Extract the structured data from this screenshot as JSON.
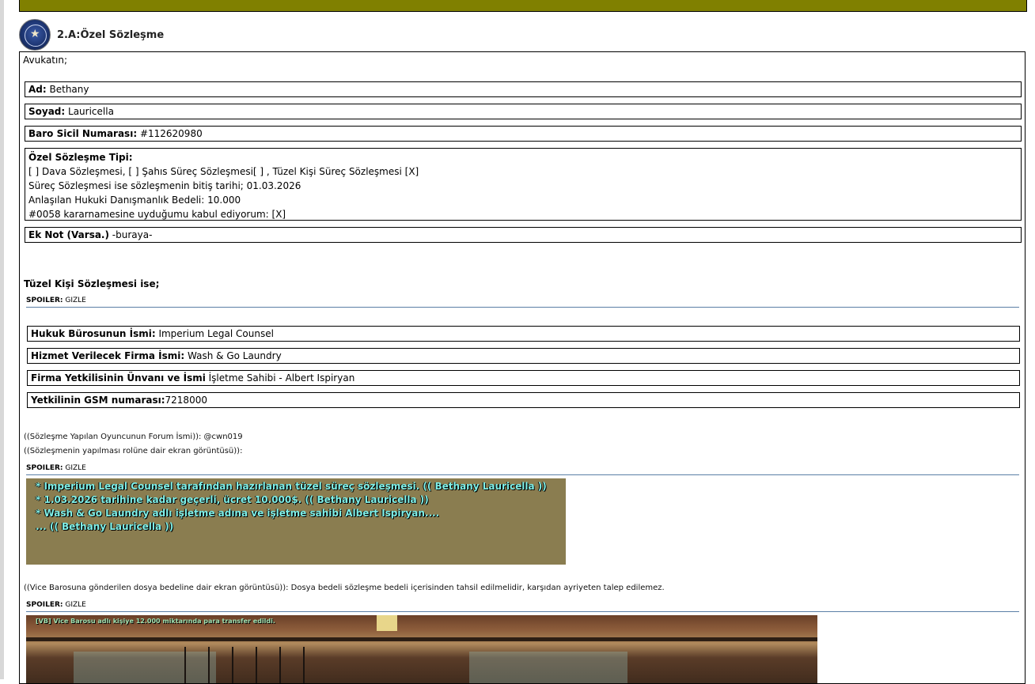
{
  "post": {
    "title": "2.A:Özel Sözleşme",
    "intro": "Avukatın;",
    "fields": [
      {
        "label": "Ad:",
        "value": " Bethany"
      },
      {
        "label": "Soyad:",
        "value": " Lauricella"
      },
      {
        "label": "Baro Sicil Numarası:",
        "value": " #112620980"
      }
    ],
    "contract_type": {
      "label": "Özel Sözleşme Tipi:",
      "lines": [
        "[ ] Dava Sözleşmesi, [ ] Şahıs Süreç Sözleşmesi[ ] , Tüzel Kişi Süreç Sözleşmesi [X]",
        "Süreç Sözleşmesi ise sözleşmenin bitiş tarihi; 01.03.2026",
        "Anlaşılan Hukuki Danışmanlık Bedeli: 10.000",
        " #0058 kararnamesine uyduğumu kabul ediyorum: [X]"
      ]
    },
    "extra_note": {
      "label": "Ek Not (Varsa.)",
      "value": " -buraya-"
    },
    "legal_entity_heading": "Tüzel Kişi Sözleşmesi ise;",
    "spoiler": {
      "label": "SPOILER:",
      "toggle": "GIZLE"
    },
    "entity_fields": [
      {
        "label": "Hukuk Bürosunun İsmi:",
        "value": " Imperium Legal Counsel"
      },
      {
        "label": "Hizmet Verilecek Firma İsmi:",
        "value": " Wash & Go Laundry"
      },
      {
        "label": "Firma Yetkilisinin Ünvanı ve İsmi",
        "value": " İşletme Sahibi - Albert Ispiryan"
      },
      {
        "label": "Yetkilinin GSM numarası:",
        "value": "7218000"
      }
    ],
    "forum_name_line": "((Sözleşme Yapılan Oyuncunun Forum İsmi)): @cwn019",
    "screenshot_note_line": "((Sözleşmenin yapılması rolüne dair ekran görüntüsü)):",
    "screenshot1_lines": [
      "* Imperium Legal Counsel tarafından hazırlanan tüzel süreç sözleşmesi. (( Bethany Lauricella ))",
      "* 1.03.2026 tarihine kadar geçerli, ücret 10.000$. (( Bethany Lauricella ))",
      "* Wash & Go Laundry adlı işletme adına ve işletme sahibi Albert Ispiryan....",
      "... (( Bethany Lauricella ))"
    ],
    "fee_line": "((Vice Barosuna gönderilen dosya bedeline dair ekran görüntüsü)): Dosya bedeli sözleşme bedeli içerisinden tahsil edilmelidir, karşıdan ayriyeten talep edilemez.",
    "screenshot2_message": "[VB] Vice Barosu adlı kişiye 12.000 miktarında para transfer edildi."
  },
  "colors": {
    "topbar": "#808000",
    "spoiler_rule": "#5b7fa6",
    "chat_text": "#7ff0e8"
  }
}
